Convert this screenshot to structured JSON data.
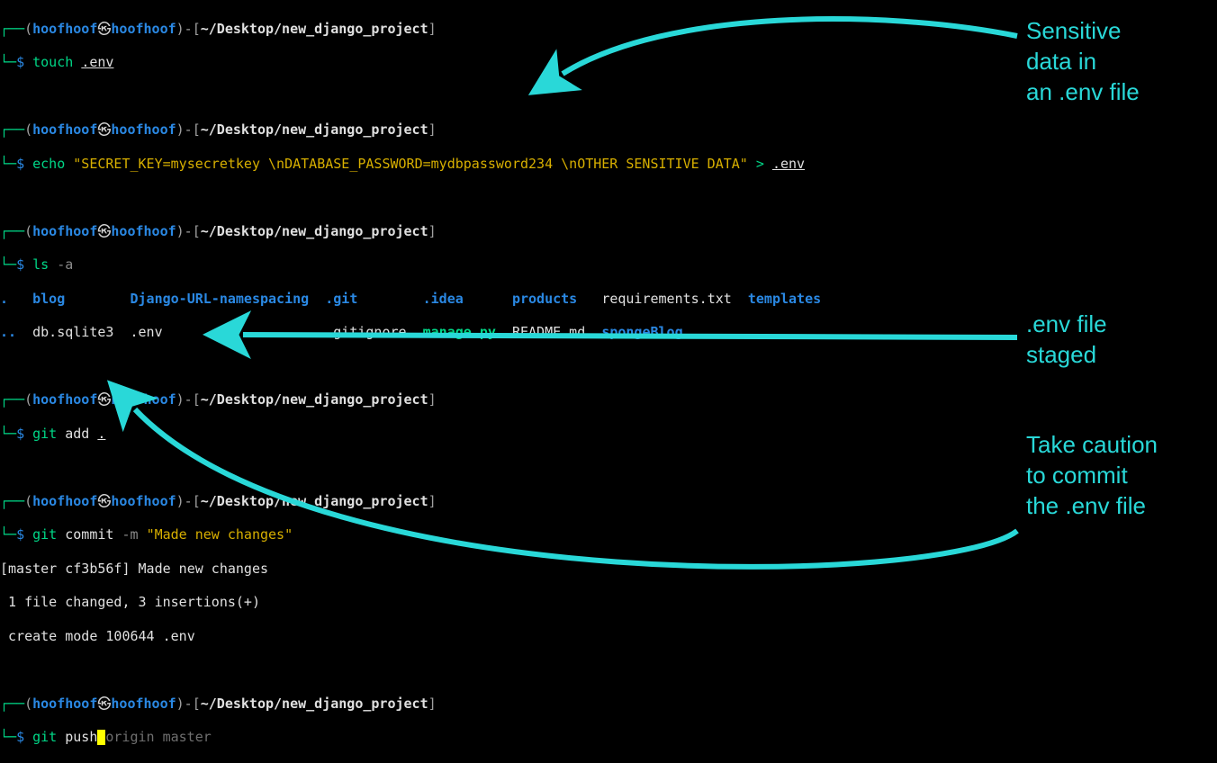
{
  "prompt": {
    "user": "hoofhoof",
    "symbol": "㉿",
    "host": "hoofhoof",
    "cwd": "~/Desktop/new_django_project",
    "dollar": "$"
  },
  "cmd1": {
    "cmd": "touch",
    "arg": ".env"
  },
  "cmd2": {
    "cmd": "echo",
    "str": "\"SECRET_KEY=mysecretkey \\nDATABASE_PASSWORD=mydbpassword234 \\nOTHER SENSITIVE DATA\"",
    "redir": ">",
    "out": ".env"
  },
  "cmd3": {
    "cmd": "ls",
    "opt": "-a"
  },
  "ls_row1": {
    "c0": ".",
    "c1": "blog",
    "c2": "Django-URL-namespacing",
    "c3": ".git",
    "c4": ".idea",
    "c5": "products",
    "c6": "requirements.txt",
    "c7": "templates"
  },
  "ls_row2": {
    "c0": "..",
    "c1": "db.sqlite3",
    "c2": ".env",
    "c3": ".gitignore",
    "c4": "manage.py",
    "c5": "README.md",
    "c6": "spongeBlog"
  },
  "cmd4": {
    "cmd": "git",
    "sub": "add",
    "arg": "."
  },
  "cmd5": {
    "cmd": "git",
    "sub": "commit",
    "opt": "-m",
    "msg": "\"Made new changes\""
  },
  "commit_out": {
    "l1": "[master cf3b56f] Made new changes",
    "l2": " 1 file changed, 3 insertions(+)",
    "l3": " create mode 100644 .env"
  },
  "cmd6": {
    "cmd": "git",
    "sub": "push",
    "rest": "origin master"
  },
  "anno1": "Sensitive\ndata in\nan .env file",
  "anno2": ".env file\nstaged",
  "anno3": "Take caution\nto commit\nthe .env file"
}
